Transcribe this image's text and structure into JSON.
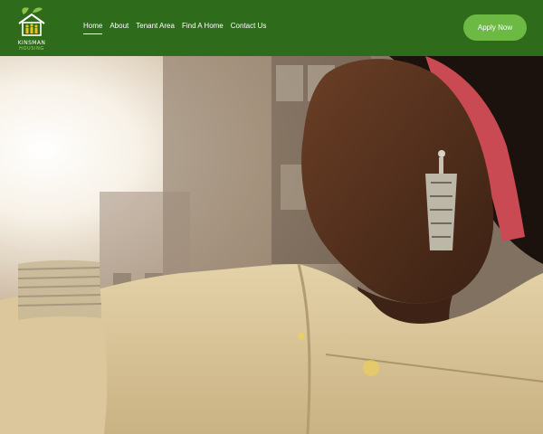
{
  "brand": {
    "name_line1": "KINSMAN",
    "name_line2": "HOUSING",
    "logo_icon": "house-with-leaves-icon"
  },
  "nav": {
    "items": [
      {
        "label": "Home",
        "active": true
      },
      {
        "label": "About",
        "active": false
      },
      {
        "label": "Tenant Area",
        "active": false
      },
      {
        "label": "Find A Home",
        "active": false
      },
      {
        "label": "Contact Us",
        "active": false
      }
    ]
  },
  "cta": {
    "label": "Apply Now"
  },
  "colors": {
    "header_bg": "#2e6b1a",
    "accent": "#6cb944",
    "logo_green": "#8bc34a"
  }
}
